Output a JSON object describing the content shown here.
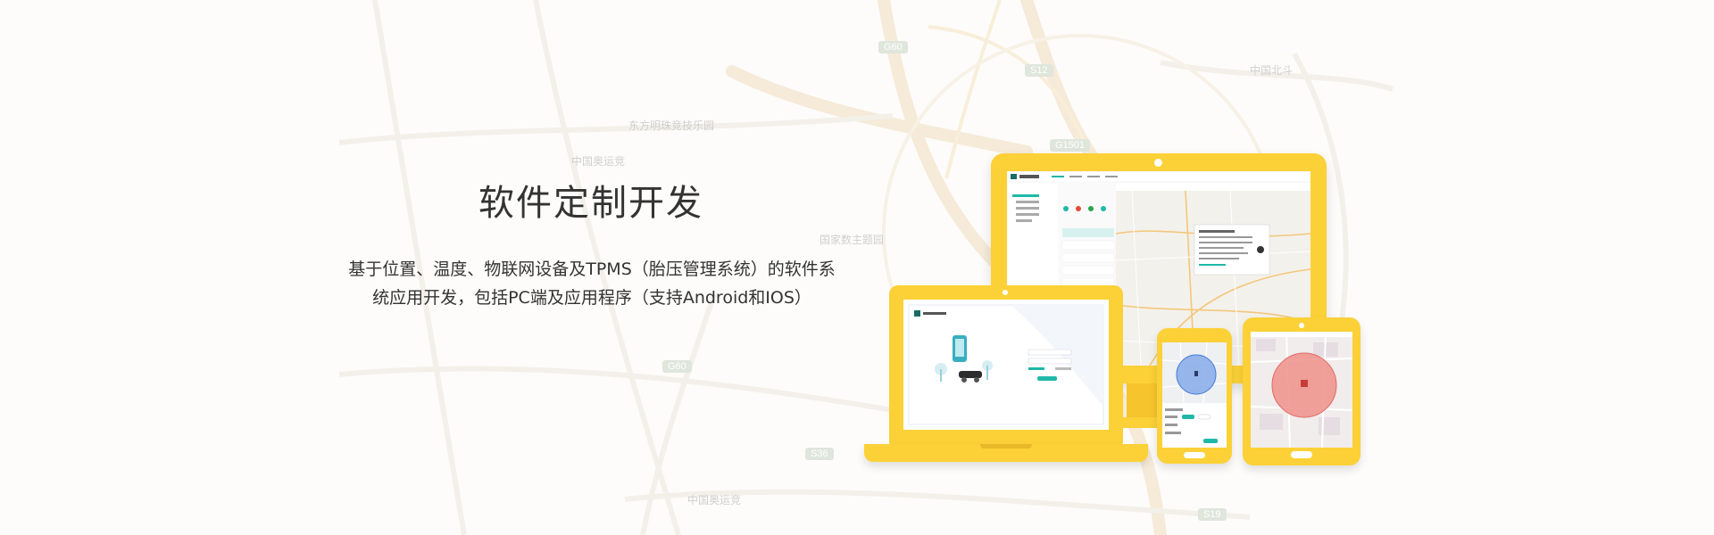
{
  "hero": {
    "title": "软件定制开发",
    "description": "基于位置、温度、物联网设备及TPMS（胎压管理系统）的软件系统应用开发，包括PC端及应用程序（支持Android和IOS）"
  },
  "map": {
    "shields": [
      "G60",
      "S12",
      "G1501",
      "G60",
      "S36",
      "S19"
    ],
    "labels": [
      "东方明珠竞技乐园",
      "中国奥运竞",
      "中国奥运竞",
      "国家数主题园",
      "中国北斗"
    ]
  },
  "colors": {
    "device_yellow": "#fcd137",
    "accent_teal": "#1fb8a8",
    "map_road": "#f4e2c7"
  },
  "screens": {
    "logo_text": "EZELOC"
  }
}
